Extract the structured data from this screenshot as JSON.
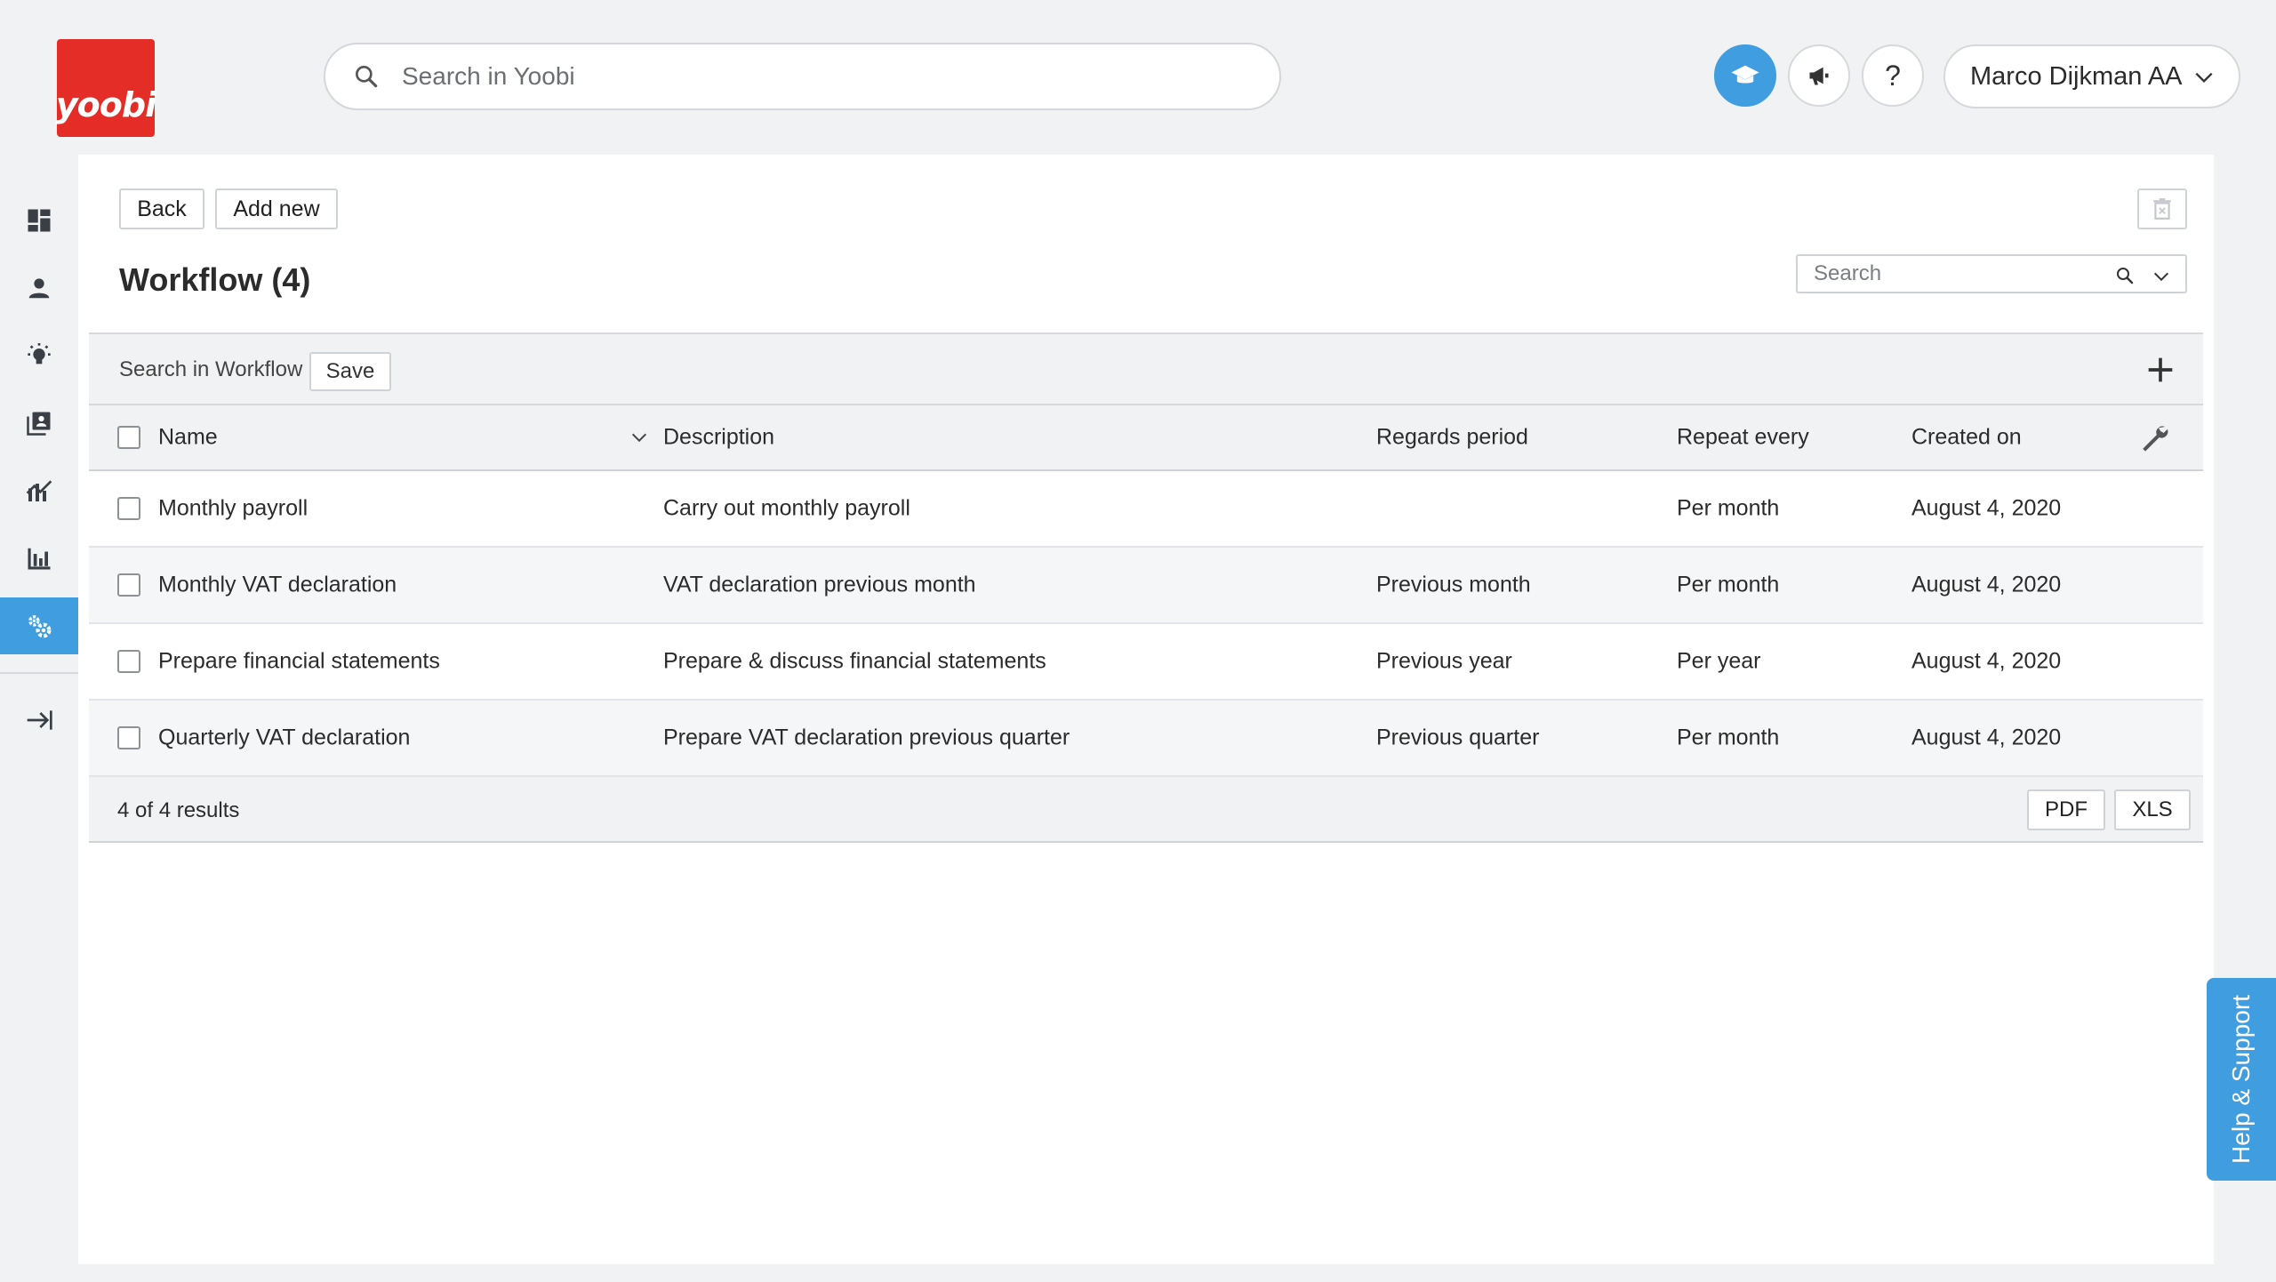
{
  "brand": {
    "logo_text": "yoobi",
    "color": "#e52d27",
    "accent": "#3f9de0"
  },
  "global_search": {
    "placeholder": "Search in Yoobi"
  },
  "top_actions": {
    "academy_icon": "graduation-cap-icon",
    "news_icon": "megaphone-icon",
    "help_label": "?",
    "user_name": "Marco Dijkman AA"
  },
  "sidebar": {
    "items": [
      {
        "icon": "dashboard-icon"
      },
      {
        "icon": "person-icon"
      },
      {
        "icon": "lightbulb-icon"
      },
      {
        "icon": "contacts-book-icon"
      },
      {
        "icon": "analytics-icon"
      },
      {
        "icon": "bar-chart-icon"
      },
      {
        "icon": "settings-gears-icon",
        "active": true
      },
      {
        "icon": "sign-out-arrow-icon"
      }
    ]
  },
  "toolbar": {
    "back_label": "Back",
    "add_new_label": "Add new"
  },
  "page": {
    "title": "Workflow (4)",
    "search_placeholder": "Search"
  },
  "grid": {
    "search_label": "Search in Workflow",
    "save_label": "Save",
    "columns": [
      "Name",
      "Description",
      "Regards period",
      "Repeat every",
      "Created on"
    ],
    "rows": [
      {
        "name": "Monthly payroll",
        "description": "Carry out monthly payroll",
        "period": "",
        "repeat": "Per month",
        "created": "August 4, 2020"
      },
      {
        "name": "Monthly VAT declaration",
        "description": "VAT declaration previous month",
        "period": "Previous month",
        "repeat": "Per month",
        "created": "August 4, 2020"
      },
      {
        "name": "Prepare financial statements",
        "description": "Prepare & discuss financial statements",
        "period": "Previous year",
        "repeat": "Per year",
        "created": "August 4, 2020"
      },
      {
        "name": "Quarterly VAT declaration",
        "description": "Prepare VAT declaration previous quarter",
        "period": "Previous quarter",
        "repeat": "Per month",
        "created": "August 4, 2020"
      }
    ],
    "result_count": "4 of 4 results",
    "pdf_label": "PDF",
    "xls_label": "XLS"
  },
  "help_tab": {
    "label": "Help & Support"
  }
}
